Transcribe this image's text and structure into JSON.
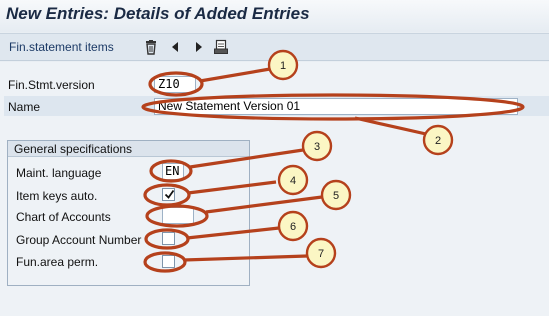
{
  "header": {
    "title": "New Entries: Details of Added Entries"
  },
  "toolbar": {
    "fin_items_label": "Fin.statement items",
    "icons": [
      "trash-icon",
      "arrow-left-icon",
      "arrow-right-icon",
      "print-icon"
    ]
  },
  "form": {
    "version_label": "Fin.Stmt.version",
    "version_value": "Z10",
    "name_label": "Name",
    "name_value": "New Statement Version 01"
  },
  "general": {
    "title": "General specifications",
    "maint_language_label": "Maint. language",
    "maint_language_value": "EN",
    "item_keys_label": "Item keys auto.",
    "item_keys_checked": true,
    "chart_label": "Chart of Accounts",
    "chart_value": "",
    "group_account_label": "Group Account Number",
    "group_account_checked": false,
    "fun_area_label": "Fun.area perm.",
    "fun_area_checked": false
  },
  "callouts": [
    "1",
    "2",
    "3",
    "4",
    "5",
    "6",
    "7"
  ],
  "colors": {
    "annotation": "#b5411c",
    "callout_fill": "#fbf6c4"
  }
}
